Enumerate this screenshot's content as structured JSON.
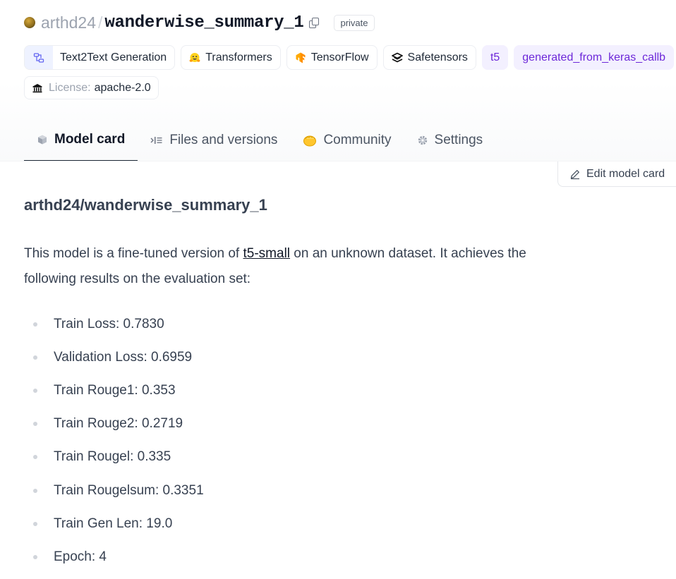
{
  "repo": {
    "owner": "arthd24",
    "separator": "/",
    "name": "wanderwise_summary_1",
    "visibility": "private"
  },
  "tags": [
    {
      "label": "Text2Text Generation",
      "icon": "text2text-icon"
    },
    {
      "label": "Transformers",
      "icon": "hugging-face-icon"
    },
    {
      "label": "TensorFlow",
      "icon": "tensorflow-icon"
    },
    {
      "label": "Safetensors",
      "icon": "safetensors-icon"
    },
    {
      "label": "t5"
    },
    {
      "label": "generated_from_keras_callb"
    }
  ],
  "license": {
    "key": "License:",
    "value": "apache-2.0",
    "icon": "bank-icon"
  },
  "tabs": [
    {
      "label": "Model card",
      "icon": "cube-icon",
      "active": true
    },
    {
      "label": "Files and versions",
      "icon": "files-icon"
    },
    {
      "label": "Community",
      "icon": "community-icon"
    },
    {
      "label": "Settings",
      "icon": "gear-icon"
    }
  ],
  "edit_button": "Edit model card",
  "card": {
    "title": "arthd24/wanderwise_summary_1",
    "desc_before": "This model is a fine-tuned version of ",
    "desc_link": "t5-small",
    "desc_after": " on an unknown dataset. It achieves the following results on the evaluation set:",
    "metrics": [
      "Train Loss: 0.7830",
      "Validation Loss: 0.6959",
      "Train Rouge1: 0.353",
      "Train Rouge2: 0.2719",
      "Train Rougel: 0.335",
      "Train Rougelsum: 0.3351",
      "Train Gen Len: 19.0",
      "Epoch: 4"
    ]
  },
  "colors": {
    "accent_purple": "#6d28d9",
    "tag_purple_bg": "#f3f0ff",
    "tab_underline": "#1f2937"
  }
}
